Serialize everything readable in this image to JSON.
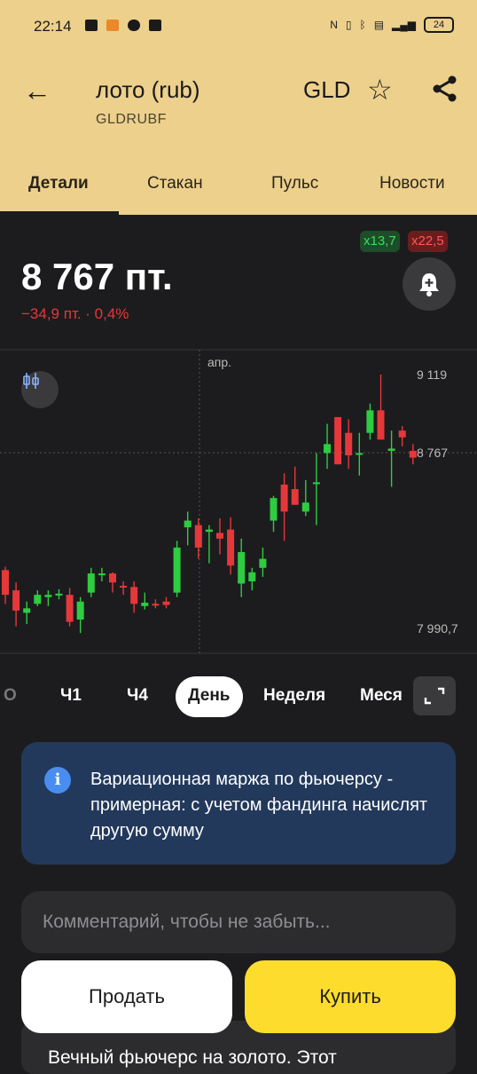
{
  "status_bar": {
    "time": "22:14",
    "battery": "24"
  },
  "header": {
    "title": "лото (rub)",
    "title_right": "GLD",
    "ticker": "GLDRUBF"
  },
  "tabs": [
    "Детали",
    "Стакан",
    "Пульс",
    "Новости"
  ],
  "quote": {
    "price": "8 767 пт.",
    "change": "−34,9 пт. · 0,4%",
    "badge_green": "x13,7",
    "badge_red": "x22,5"
  },
  "chart_labels": {
    "month": "апр.",
    "high": "9 119",
    "current": "8 767",
    "low": "7 990,7"
  },
  "periods": {
    "partial_left": "О",
    "h1": "Ч1",
    "h4": "Ч4",
    "day": "День",
    "week": "Неделя",
    "month_partial": "Меся"
  },
  "info_banner": {
    "text": "Вариационная маржа по фьючерсу - примерная: с учетом фандинга начислят другую сумму"
  },
  "comment": {
    "placeholder": "Комментарий, чтобы не забыть..."
  },
  "actions": {
    "sell": "Продать",
    "buy": "Купить"
  },
  "footer": {
    "text": "Вечный фьючерс на золото. Этот"
  },
  "colors": {
    "header_bg": "#ecd08c",
    "up": "#2ecc40",
    "down": "#e5383b",
    "buy": "#fddc2d",
    "info_bg": "#22395c"
  },
  "chart_data": {
    "type": "candlestick",
    "y_ticks": [
      "9 119",
      "8 767",
      "7 990,7"
    ],
    "x_tick_labels": [
      "апр."
    ],
    "ohlc": [
      {
        "o": 8250,
        "h": 8265,
        "l": 8100,
        "c": 8140
      },
      {
        "o": 8160,
        "h": 8195,
        "l": 8000,
        "c": 8070
      },
      {
        "o": 8060,
        "h": 8110,
        "l": 8010,
        "c": 8080
      },
      {
        "o": 8100,
        "h": 8160,
        "l": 8090,
        "c": 8140
      },
      {
        "o": 8130,
        "h": 8160,
        "l": 8090,
        "c": 8140
      },
      {
        "o": 8140,
        "h": 8165,
        "l": 8120,
        "c": 8145
      },
      {
        "o": 8140,
        "h": 8170,
        "l": 8000,
        "c": 8020
      },
      {
        "o": 8030,
        "h": 8130,
        "l": 7970,
        "c": 8110
      },
      {
        "o": 8150,
        "h": 8260,
        "l": 8130,
        "c": 8235
      },
      {
        "o": 8230,
        "h": 8260,
        "l": 8200,
        "c": 8235
      },
      {
        "o": 8235,
        "h": 8240,
        "l": 8150,
        "c": 8195
      },
      {
        "o": 8180,
        "h": 8200,
        "l": 8140,
        "c": 8175
      },
      {
        "o": 8175,
        "h": 8200,
        "l": 8060,
        "c": 8100
      },
      {
        "o": 8090,
        "h": 8150,
        "l": 8075,
        "c": 8105
      },
      {
        "o": 8100,
        "h": 8120,
        "l": 8080,
        "c": 8095
      },
      {
        "o": 8110,
        "h": 8130,
        "l": 8080,
        "c": 8095
      },
      {
        "o": 8150,
        "h": 8380,
        "l": 8130,
        "c": 8350
      },
      {
        "o": 8440,
        "h": 8510,
        "l": 8360,
        "c": 8470
      },
      {
        "o": 8450,
        "h": 8480,
        "l": 8300,
        "c": 8350
      },
      {
        "o": 8420,
        "h": 8450,
        "l": 8280,
        "c": 8430
      },
      {
        "o": 8415,
        "h": 8480,
        "l": 8320,
        "c": 8390
      },
      {
        "o": 8430,
        "h": 8485,
        "l": 8230,
        "c": 8270
      },
      {
        "o": 8190,
        "h": 8390,
        "l": 8130,
        "c": 8330
      },
      {
        "o": 8200,
        "h": 8260,
        "l": 8160,
        "c": 8240
      },
      {
        "o": 8260,
        "h": 8350,
        "l": 8220,
        "c": 8300
      },
      {
        "o": 8470,
        "h": 8580,
        "l": 8420,
        "c": 8570
      },
      {
        "o": 8630,
        "h": 8680,
        "l": 8380,
        "c": 8510
      },
      {
        "o": 8610,
        "h": 8710,
        "l": 8570,
        "c": 8540
      },
      {
        "o": 8510,
        "h": 8650,
        "l": 8490,
        "c": 8550
      },
      {
        "o": 8640,
        "h": 8770,
        "l": 8450,
        "c": 8640
      },
      {
        "o": 8770,
        "h": 8900,
        "l": 8700,
        "c": 8810
      },
      {
        "o": 8930,
        "h": 8930,
        "l": 8720,
        "c": 8720
      },
      {
        "o": 8860,
        "h": 8920,
        "l": 8700,
        "c": 8760
      },
      {
        "o": 8770,
        "h": 8860,
        "l": 8670,
        "c": 8770
      },
      {
        "o": 8860,
        "h": 8990,
        "l": 8830,
        "c": 8960
      },
      {
        "o": 8960,
        "h": 9119,
        "l": 8870,
        "c": 8830
      },
      {
        "o": 8780,
        "h": 8870,
        "l": 8620,
        "c": 8790
      },
      {
        "o": 8870,
        "h": 8890,
        "l": 8800,
        "c": 8840
      },
      {
        "o": 8780,
        "h": 8810,
        "l": 8720,
        "c": 8750
      }
    ]
  }
}
